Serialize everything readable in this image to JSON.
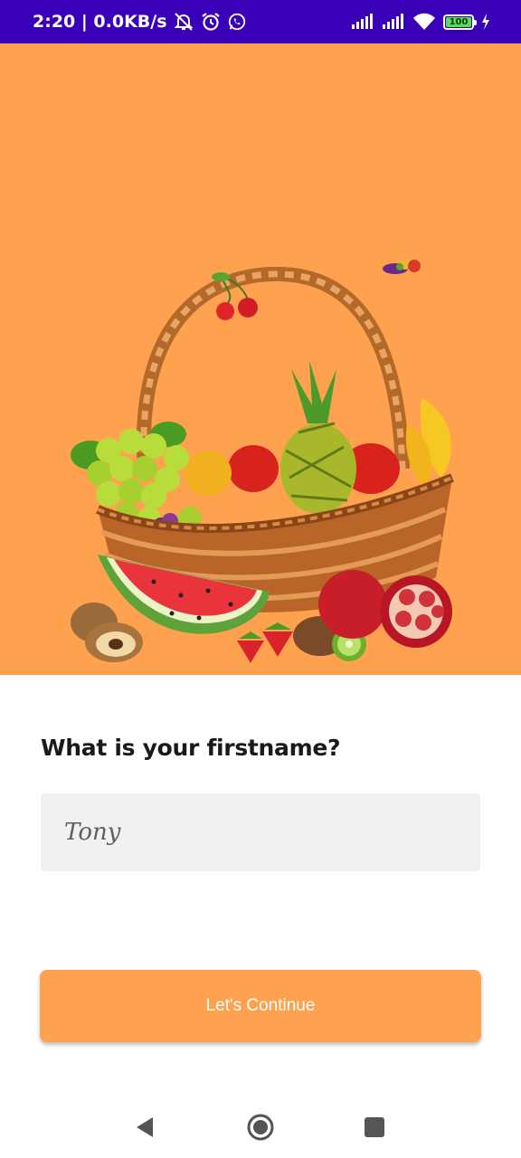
{
  "status_bar": {
    "time_net": "2:20 | 0.0KB/s",
    "icons": [
      "muted-bell-icon",
      "alarm-icon",
      "whatsapp-icon",
      "signal-icon",
      "signal-icon",
      "wifi-icon",
      "battery-icon",
      "charging-icon"
    ],
    "battery_level": "100"
  },
  "hero": {
    "illustration": "fruit-basket"
  },
  "form": {
    "question": "What is your firstname?",
    "name_placeholder": "Tony",
    "name_value": ""
  },
  "actions": {
    "continue_label": "Let's Continue"
  },
  "nav_bar": {
    "icons": [
      "back-icon",
      "home-icon",
      "recents-icon"
    ]
  },
  "colors": {
    "status_bar": "#3a00b7",
    "accent": "#ffa24f",
    "input_bg": "#f2f0f0"
  }
}
